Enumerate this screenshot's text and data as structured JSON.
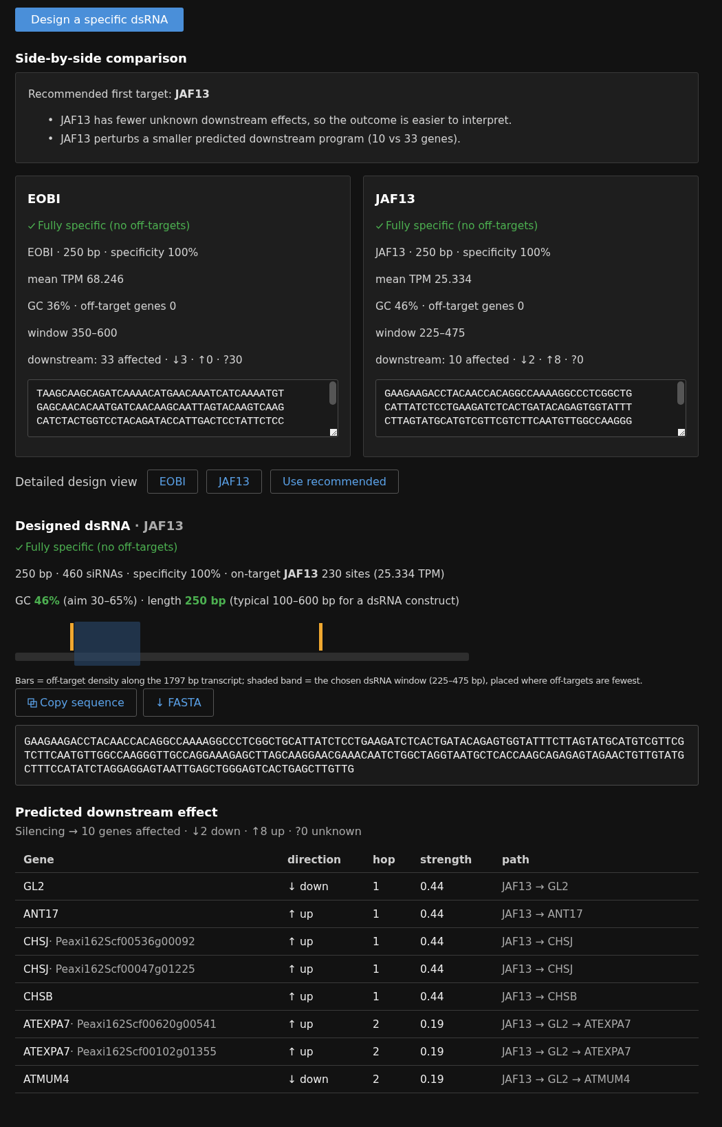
{
  "design_button": "Design a specific dsRNA",
  "comparison": {
    "heading": "Side-by-side comparison",
    "recommendation": {
      "label": "Recommended first target:",
      "target": "JAF13",
      "reasons": [
        {
          "marker": "•",
          "text": "JAF13 has fewer unknown downstream effects, so the outcome is easier to interpret."
        },
        {
          "marker": "•",
          "text": "JAF13 perturbs a smaller predicted downstream program (10 vs 33 genes)."
        }
      ]
    },
    "cards": [
      {
        "title": "EOBI",
        "status": {
          "kind": "ok",
          "text": "Fully specific (no off-targets)"
        },
        "facts": [
          "EOBI · 250 bp · specificity 100%",
          "mean TPM 68.246",
          "GC 36% · off-target genes 0",
          "window 350–600",
          "downstream: 33 affected · ↓3 · ↑0 · ?30"
        ],
        "sequence": "TAAGCAAGCAGATCAAAACATGAACAAATCATCAAAATGT\nGAGCAACACAATGATCAACAAGCAATTAGTACAAGTCAAG\nCATCTACTGGTCCTACAGATACCATTGACTCCTATTCTCC"
      },
      {
        "title": "JAF13",
        "status": {
          "kind": "ok",
          "text": "Fully specific (no off-targets)"
        },
        "facts": [
          "JAF13 · 250 bp · specificity 100%",
          "mean TPM 25.334",
          "GC 46% · off-target genes 0",
          "window 225–475",
          "downstream: 10 affected · ↓2 · ↑8 · ?0"
        ],
        "sequence": "GAAGAAGACCTACAACCACAGGCCAAAAGGCCCTCGGCTG\nCATTATCTCCTGAAGATCTCACTGATACAGAGTGGTATTT\nCTTAGTATGCATGTCGTTCGTCTTCAATGTTGGCCAAGGG"
      }
    ]
  },
  "detail_view": {
    "label": "Detailed design view",
    "buttons": [
      "EOBI",
      "JAF13",
      "Use recommended"
    ]
  },
  "design": {
    "title": "Designed dsRNA",
    "target": "· JAF13",
    "status": {
      "kind": "ok",
      "text": "Fully specific (no off-targets)"
    },
    "summary": "250 bp · 460 siRNAs · specificity 100% · on-target **JAF13** 230 sites (25.334 TPM)",
    "gc_line": "GC **46%** (aim 30–65%) · length **250 bp** (typical 100–600 bp for a dsRNA construct)",
    "caption": "Bars = off-target density along the 1797 bp transcript; shaded band = the chosen dsRNA window (225–475 bp), placed where off-targets are fewest.",
    "actions": [
      {
        "kind": "copy",
        "label": "Copy sequence"
      },
      {
        "kind": "download",
        "label": "↓ FASTA"
      }
    ],
    "sequence": "GAAGAAGACCTACAACCACAGGCCAAAAGGCCCTCGGCTGCATTATCTCCTGAAGATCTCACTGATACAGAGTGGTATTTCTTAGTATGCATGTCGTTCGTCTTCAATGTTGGCCAAGGGTTGCCAGGAAAGAGCTTAGCAAGGAACGAAACAATCTGGCTAGGTAATGCTCACCAAGCAGAGAGTAGAACTGTTGTATGCTTTCCATATCTAGGAGGAGTAATTGAGCTGGGAGTCACTGAGCTTGTTG"
  },
  "downstream": {
    "heading": "Predicted downstream effect",
    "summary": "Silencing → 10 genes affected · ↓2 down · ↑8 up · ?0 unknown",
    "columns": [
      "Gene",
      "direction",
      "hop",
      "strength",
      "path"
    ],
    "rows": [
      {
        "gene": "GL2",
        "direction": "↓ down",
        "hop": "1",
        "strength": "0.44",
        "path": "JAF13 → GL2"
      },
      {
        "gene": "ANT17",
        "direction": "↑ up",
        "hop": "1",
        "strength": "0.44",
        "path": "JAF13 → ANT17"
      },
      {
        "gene": "CHSJ",
        "gene_id": "· Peaxi162Scf00536g00092",
        "direction": "↑ up",
        "hop": "1",
        "strength": "0.44",
        "path": "JAF13 → CHSJ"
      },
      {
        "gene": "CHSJ",
        "gene_id": "· Peaxi162Scf00047g01225",
        "direction": "↑ up",
        "hop": "1",
        "strength": "0.44",
        "path": "JAF13 → CHSJ"
      },
      {
        "gene": "CHSB",
        "direction": "↑ up",
        "hop": "1",
        "strength": "0.44",
        "path": "JAF13 → CHSB"
      },
      {
        "gene": "ATEXPA7",
        "gene_id": "· Peaxi162Scf00620g00541",
        "direction": "↑ up",
        "hop": "2",
        "strength": "0.19",
        "path": "JAF13 → GL2 → ATEXPA7"
      },
      {
        "gene": "ATEXPA7",
        "gene_id": "· Peaxi162Scf00102g01355",
        "direction": "↑ up",
        "hop": "2",
        "strength": "0.19",
        "path": "JAF13 → GL2 → ATEXPA7"
      },
      {
        "gene": "ATMUM4",
        "direction": "↓ down",
        "hop": "2",
        "strength": "0.19",
        "path": "JAF13 → GL2 → ATMUM4"
      }
    ]
  }
}
